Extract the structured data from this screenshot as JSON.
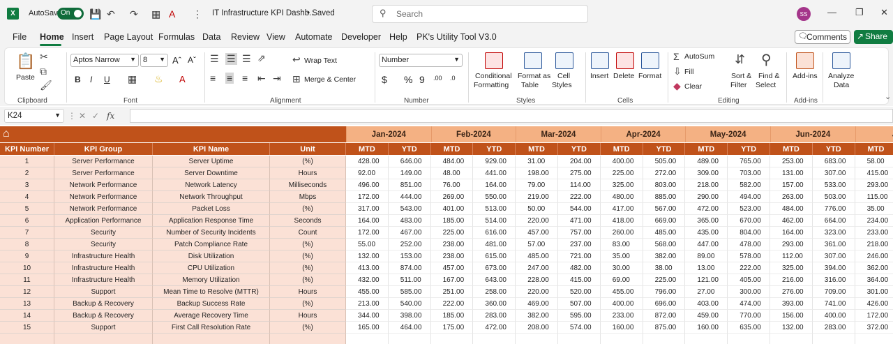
{
  "titlebar": {
    "autosave_label": "AutoSave",
    "autosave_state": "On",
    "doc_title": "IT Infrastructure KPI Dashb...",
    "saved_label": "• Saved",
    "search_placeholder": "Search",
    "avatar_initials": "SS"
  },
  "menu": {
    "items": [
      "File",
      "Home",
      "Insert",
      "Page Layout",
      "Formulas",
      "Data",
      "Review",
      "View",
      "Automate",
      "Developer",
      "Help",
      "PK's Utility Tool V3.0"
    ],
    "active": "Home",
    "comments_label": "Comments",
    "share_label": "Share"
  },
  "ribbon": {
    "clipboard": {
      "paste": "Paste",
      "group": "Clipboard"
    },
    "font": {
      "name": "Aptos Narrow",
      "size": "8",
      "group": "Font"
    },
    "alignment": {
      "wrap": "Wrap Text",
      "merge": "Merge & Center",
      "group": "Alignment"
    },
    "number": {
      "format": "Number",
      "group": "Number"
    },
    "styles": {
      "cond1": "Conditional",
      "cond2": "Formatting",
      "fmt1": "Format as",
      "fmt2": "Table",
      "cell1": "Cell",
      "cell2": "Styles",
      "group": "Styles"
    },
    "cells": {
      "insert": "Insert",
      "delete": "Delete",
      "format": "Format",
      "group": "Cells"
    },
    "editing": {
      "autosum": "AutoSum",
      "fill": "Fill",
      "clear": "Clear",
      "sort1": "Sort &",
      "sort2": "Filter",
      "find1": "Find &",
      "find2": "Select",
      "group": "Editing"
    },
    "addins": {
      "label": "Add-ins",
      "group": "Add-ins"
    },
    "analyze": {
      "line1": "Analyze",
      "line2": "Data"
    }
  },
  "formula_bar": {
    "cell_ref": "K24",
    "formula": ""
  },
  "sheet": {
    "headers": [
      "KPI Number",
      "KPI Group",
      "KPI Name",
      "Unit"
    ],
    "months": [
      "Jan-2024",
      "Feb-2024",
      "Mar-2024",
      "Apr-2024",
      "May-2024",
      "Jun-2024",
      "Jul"
    ],
    "sub_headers": [
      "MTD",
      "YTD"
    ],
    "rows": [
      {
        "num": "1",
        "group": "Server Performance",
        "name": "Server Uptime",
        "unit": "(%)",
        "values": [
          "428.00",
          "646.00",
          "484.00",
          "929.00",
          "31.00",
          "204.00",
          "400.00",
          "505.00",
          "489.00",
          "765.00",
          "253.00",
          "683.00",
          "58.00"
        ]
      },
      {
        "num": "2",
        "group": "Server Performance",
        "name": "Server Downtime",
        "unit": "Hours",
        "values": [
          "92.00",
          "149.00",
          "48.00",
          "441.00",
          "198.00",
          "275.00",
          "225.00",
          "272.00",
          "309.00",
          "703.00",
          "131.00",
          "307.00",
          "415.00"
        ]
      },
      {
        "num": "3",
        "group": "Network Performance",
        "name": "Network Latency",
        "unit": "Milliseconds",
        "values": [
          "496.00",
          "851.00",
          "76.00",
          "164.00",
          "79.00",
          "114.00",
          "325.00",
          "803.00",
          "218.00",
          "582.00",
          "157.00",
          "533.00",
          "293.00"
        ]
      },
      {
        "num": "4",
        "group": "Network Performance",
        "name": "Network Throughput",
        "unit": "Mbps",
        "values": [
          "172.00",
          "444.00",
          "269.00",
          "550.00",
          "219.00",
          "222.00",
          "480.00",
          "885.00",
          "290.00",
          "494.00",
          "263.00",
          "503.00",
          "115.00"
        ]
      },
      {
        "num": "5",
        "group": "Network Performance",
        "name": "Packet Loss",
        "unit": "(%)",
        "values": [
          "317.00",
          "543.00",
          "401.00",
          "513.00",
          "50.00",
          "544.00",
          "417.00",
          "567.00",
          "472.00",
          "523.00",
          "484.00",
          "776.00",
          "35.00"
        ]
      },
      {
        "num": "6",
        "group": "Application Performance",
        "name": "Application Response Time",
        "unit": "Seconds",
        "values": [
          "164.00",
          "483.00",
          "185.00",
          "514.00",
          "220.00",
          "471.00",
          "418.00",
          "669.00",
          "365.00",
          "670.00",
          "462.00",
          "664.00",
          "234.00"
        ]
      },
      {
        "num": "7",
        "group": "Security",
        "name": "Number of Security Incidents",
        "unit": "Count",
        "values": [
          "172.00",
          "467.00",
          "225.00",
          "616.00",
          "457.00",
          "757.00",
          "260.00",
          "485.00",
          "435.00",
          "804.00",
          "164.00",
          "323.00",
          "233.00"
        ]
      },
      {
        "num": "8",
        "group": "Security",
        "name": "Patch Compliance Rate",
        "unit": "(%)",
        "values": [
          "55.00",
          "252.00",
          "238.00",
          "481.00",
          "57.00",
          "237.00",
          "83.00",
          "568.00",
          "447.00",
          "478.00",
          "293.00",
          "361.00",
          "218.00"
        ]
      },
      {
        "num": "9",
        "group": "Infrastructure Health",
        "name": "Disk Utilization",
        "unit": "(%)",
        "values": [
          "132.00",
          "153.00",
          "238.00",
          "615.00",
          "485.00",
          "721.00",
          "35.00",
          "382.00",
          "89.00",
          "578.00",
          "112.00",
          "307.00",
          "246.00"
        ]
      },
      {
        "num": "10",
        "group": "Infrastructure Health",
        "name": "CPU Utilization",
        "unit": "(%)",
        "values": [
          "413.00",
          "874.00",
          "457.00",
          "673.00",
          "247.00",
          "482.00",
          "30.00",
          "38.00",
          "13.00",
          "222.00",
          "325.00",
          "394.00",
          "362.00"
        ]
      },
      {
        "num": "11",
        "group": "Infrastructure Health",
        "name": "Memory Utilization",
        "unit": "(%)",
        "values": [
          "432.00",
          "511.00",
          "167.00",
          "643.00",
          "228.00",
          "415.00",
          "69.00",
          "225.00",
          "121.00",
          "405.00",
          "216.00",
          "316.00",
          "364.00"
        ]
      },
      {
        "num": "12",
        "group": "Support",
        "name": "Mean Time to Resolve (MTTR)",
        "unit": "Hours",
        "values": [
          "455.00",
          "585.00",
          "251.00",
          "258.00",
          "220.00",
          "520.00",
          "455.00",
          "796.00",
          "27.00",
          "300.00",
          "276.00",
          "709.00",
          "301.00"
        ]
      },
      {
        "num": "13",
        "group": "Backup & Recovery",
        "name": "Backup Success Rate",
        "unit": "(%)",
        "values": [
          "213.00",
          "540.00",
          "222.00",
          "360.00",
          "469.00",
          "507.00",
          "400.00",
          "696.00",
          "403.00",
          "474.00",
          "393.00",
          "741.00",
          "426.00"
        ]
      },
      {
        "num": "14",
        "group": "Backup & Recovery",
        "name": "Average Recovery Time",
        "unit": "Hours",
        "values": [
          "344.00",
          "398.00",
          "185.00",
          "283.00",
          "382.00",
          "595.00",
          "233.00",
          "872.00",
          "459.00",
          "770.00",
          "156.00",
          "400.00",
          "172.00"
        ]
      },
      {
        "num": "15",
        "group": "Support",
        "name": "First Call Resolution Rate",
        "unit": "(%)",
        "values": [
          "165.00",
          "464.00",
          "175.00",
          "472.00",
          "208.00",
          "574.00",
          "160.00",
          "875.00",
          "160.00",
          "635.00",
          "132.00",
          "283.00",
          "372.00"
        ]
      }
    ]
  }
}
